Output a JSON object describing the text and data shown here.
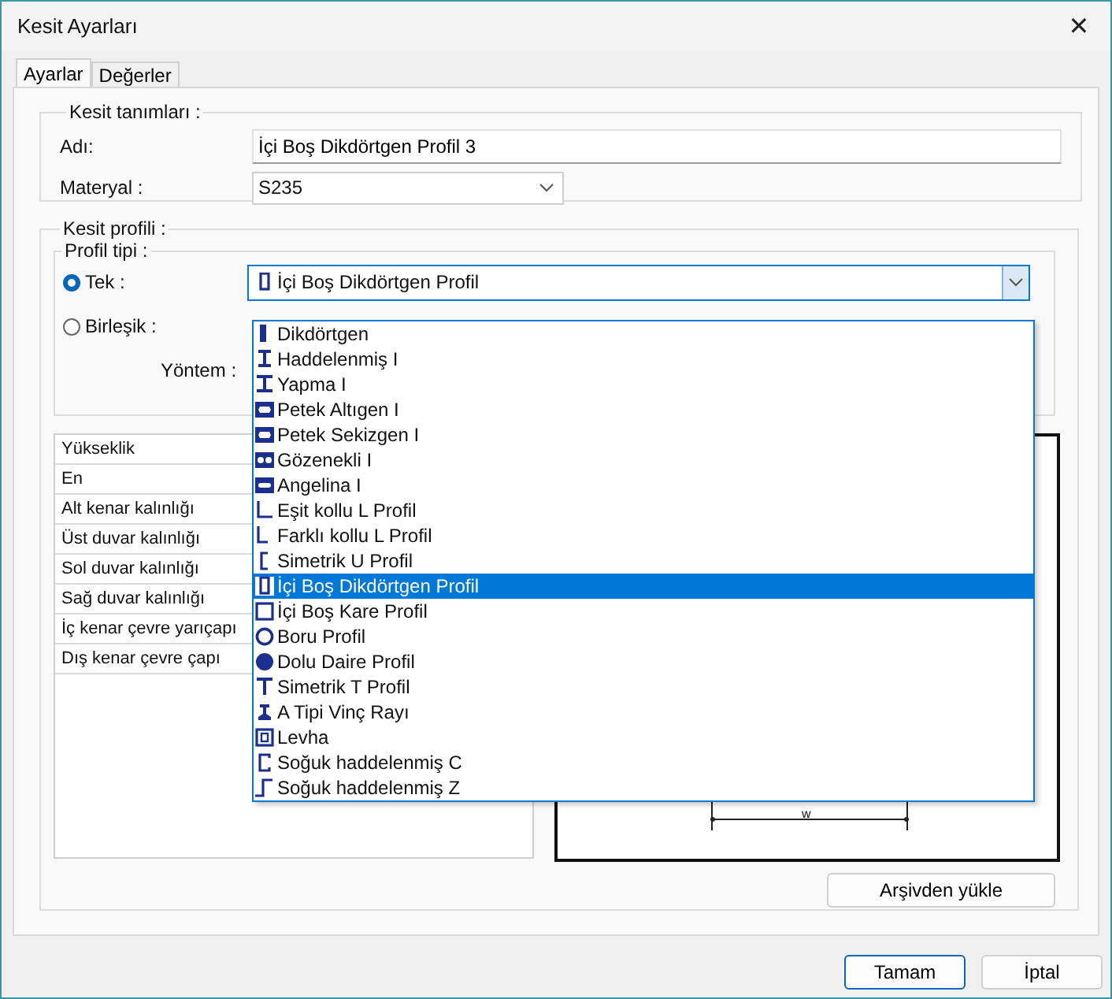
{
  "window": {
    "title": "Kesit Ayarları",
    "close": "✕"
  },
  "tabs": [
    {
      "label": "Ayarlar",
      "selected": true
    },
    {
      "label": "Değerler",
      "selected": false
    }
  ],
  "section_definitions": {
    "title": "Kesit tanımları :",
    "name_label": "Adı:",
    "name_value": "İçi Boş Dikdörtgen Profil 3",
    "material_label": "Materyal :",
    "material_value": "S235"
  },
  "section_profile": {
    "title": "Kesit profili :",
    "profile_type": {
      "title": "Profil tipi :",
      "options": [
        {
          "label": "Tek :",
          "selected": true
        },
        {
          "label": "Birleşik :",
          "selected": false
        }
      ],
      "method_label": "Yöntem :",
      "combo": {
        "value": "İçi Boş Dikdörtgen Profil",
        "kind": "hollow-rect"
      },
      "dropdown": [
        {
          "label": "Dikdörtgen",
          "kind": "bar",
          "selected": false
        },
        {
          "label": "Haddelenmiş I",
          "kind": "ibeam",
          "selected": false
        },
        {
          "label": "Yapma I",
          "kind": "ibeam-wide",
          "selected": false
        },
        {
          "label": "Petek Altıgen I",
          "kind": "web-hex",
          "selected": false
        },
        {
          "label": "Petek Sekizgen I",
          "kind": "web-oct",
          "selected": false
        },
        {
          "label": "Gözenekli I",
          "kind": "web-holes",
          "selected": false
        },
        {
          "label": "Angelina I",
          "kind": "web-slot",
          "selected": false
        },
        {
          "label": "Eşit kollu L Profil",
          "kind": "angle",
          "selected": false
        },
        {
          "label": "Farklı kollu L Profil",
          "kind": "angle-short",
          "selected": false
        },
        {
          "label": "Simetrik U Profil",
          "kind": "channel",
          "selected": false
        },
        {
          "label": "İçi Boş Dikdörtgen Profil",
          "kind": "hollow-rect",
          "selected": true
        },
        {
          "label": "İçi Boş Kare Profil",
          "kind": "hollow-square",
          "selected": false
        },
        {
          "label": "Boru Profil",
          "kind": "tube",
          "selected": false
        },
        {
          "label": "Dolu Daire Profil",
          "kind": "disc",
          "selected": false
        },
        {
          "label": "Simetrik T Profil",
          "kind": "tee",
          "selected": false
        },
        {
          "label": "A Tipi Vinç Rayı",
          "kind": "rail",
          "selected": false
        },
        {
          "label": "Levha",
          "kind": "plate",
          "selected": false
        },
        {
          "label": "Soğuk haddelenmiş C",
          "kind": "cold-c",
          "selected": false
        },
        {
          "label": "Soğuk haddelenmiş Z",
          "kind": "cold-z",
          "selected": false
        }
      ]
    },
    "properties": [
      "Yükseklik",
      "En",
      "Alt kenar kalınlığı",
      "Üst duvar kalınlığı",
      "Sol duvar kalınlığı",
      "Sağ duvar kalınlığı",
      "İç kenar çevre yarıçapı",
      "Dış kenar çevre çapı"
    ],
    "preview_dimension": "w",
    "load_button": "Arşivden yükle"
  },
  "buttons": [
    "Tamam",
    "İptal"
  ]
}
